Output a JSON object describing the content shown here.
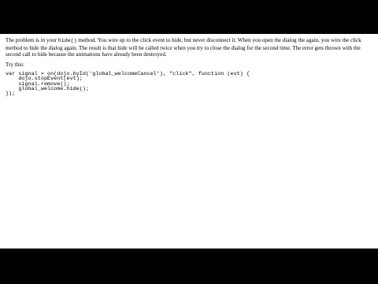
{
  "answer": {
    "part1": "The problem is in your",
    "method_name": "hide()",
    "part2": "method. You wire up to the click event to hide, but never disconnect it. When you open the dialog the again, you wire the click method to hide the dialog again. The result is that hide will be called twice when you try to close the dialog for the second time. The error gets thrown with the second call to hide because the animations have already been destroyed.",
    "try_label": "Try this:",
    "code_lines": [
      "var signal = on(dojo.byId('global_welcomeCancel'), \"click\", function (evt) {",
      "    dojo.stopEvent(evt);",
      "    signal.remove();",
      "    global_welcome.hide();",
      "});"
    ]
  }
}
